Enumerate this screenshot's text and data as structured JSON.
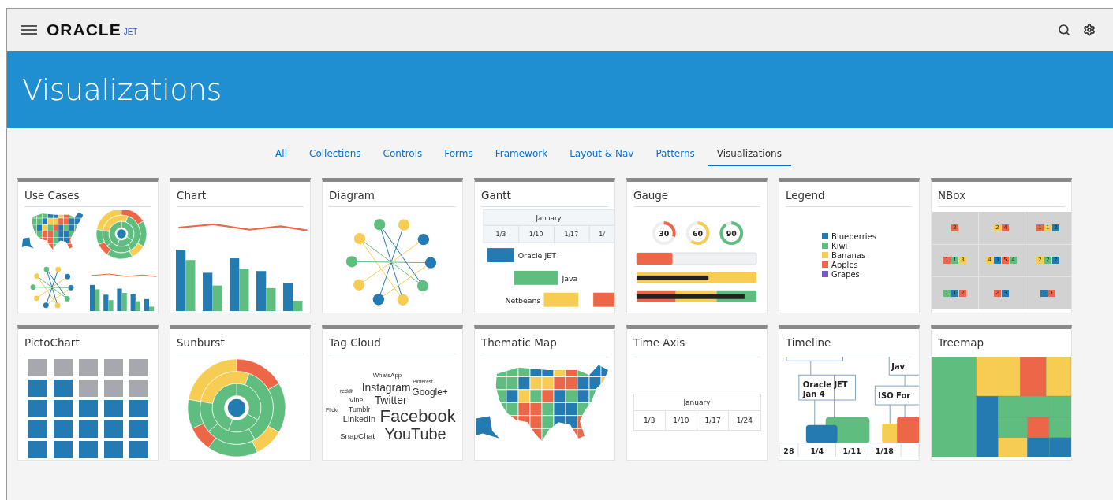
{
  "header": {
    "logo": "ORACLE",
    "product": "JET"
  },
  "banner": {
    "title": "Visualizations"
  },
  "tabs": [
    {
      "label": "All",
      "selected": false
    },
    {
      "label": "Collections",
      "selected": false
    },
    {
      "label": "Controls",
      "selected": false
    },
    {
      "label": "Forms",
      "selected": false
    },
    {
      "label": "Framework",
      "selected": false
    },
    {
      "label": "Layout & Nav",
      "selected": false
    },
    {
      "label": "Patterns",
      "selected": false
    },
    {
      "label": "Visualizations",
      "selected": true
    }
  ],
  "cards": [
    {
      "title": "Use Cases",
      "kind": "usecases"
    },
    {
      "title": "Chart",
      "kind": "chart"
    },
    {
      "title": "Diagram",
      "kind": "diagram"
    },
    {
      "title": "Gantt",
      "kind": "gantt",
      "month": "January",
      "dates": [
        "1/3",
        "1/10",
        "1/17",
        "1/"
      ],
      "tasks": [
        {
          "label": "Oracle JET",
          "color": "#237bb1"
        },
        {
          "label": "Java",
          "color": "#5fbe7f"
        },
        {
          "label": "Netbeans",
          "color": "#f6cd52"
        }
      ]
    },
    {
      "title": "Gauge",
      "kind": "gauge",
      "rings": [
        {
          "reading": "30",
          "level": 0.3,
          "color": "#ed6647"
        },
        {
          "reading": "60",
          "level": 0.6,
          "color": "#f6cd52"
        },
        {
          "reading": "90",
          "level": 0.9,
          "color": "#5fbe7f"
        }
      ],
      "bars": [
        {
          "kind": "plain",
          "level": 0.3
        },
        {
          "kind": "marker",
          "level": 0.6
        },
        {
          "kind": "ranged",
          "level": 0.9
        }
      ]
    },
    {
      "title": "Legend",
      "kind": "legend",
      "items": [
        {
          "label": "Blueberries",
          "color": "#237bb1"
        },
        {
          "label": "Kiwi",
          "color": "#5fbe7f"
        },
        {
          "label": "Bananas",
          "color": "#f6cd52"
        },
        {
          "label": "Apples",
          "color": "#ed6647"
        },
        {
          "label": "Grapes",
          "color": "#7e57c2"
        }
      ]
    },
    {
      "title": "NBox",
      "kind": "nbox",
      "cells": [
        [
          {
            "label": "2",
            "color": "#ed6647"
          }
        ],
        [
          {
            "label": "2",
            "color": "#f6cd52"
          },
          {
            "label": "4",
            "color": "#ed6647"
          }
        ],
        [
          {
            "label": "1",
            "color": "#ed6647"
          },
          {
            "label": "1",
            "color": "#f6cd52"
          },
          {
            "label": "2",
            "color": "#237bb1"
          }
        ],
        [
          {
            "label": "1",
            "color": "#ed6647"
          },
          {
            "label": "1",
            "color": "#5fbe7f"
          },
          {
            "label": "3",
            "color": "#f6cd52"
          }
        ],
        [
          {
            "label": "4",
            "color": "#f6cd52"
          },
          {
            "label": "3",
            "color": "#237bb1"
          },
          {
            "label": "5",
            "color": "#ed6647"
          },
          {
            "label": "4",
            "color": "#5fbe7f"
          }
        ],
        [
          {
            "label": "2",
            "color": "#f6cd52"
          },
          {
            "label": "2",
            "color": "#5fbe7f"
          },
          {
            "label": "2",
            "color": "#237bb1"
          }
        ],
        [
          {
            "label": "1",
            "color": "#5fbe7f"
          },
          {
            "label": "1",
            "color": "#237bb1"
          },
          {
            "label": "2",
            "color": "#ed6647"
          }
        ],
        [
          {
            "label": "2",
            "color": "#ed6647"
          },
          {
            "label": "3",
            "color": "#237bb1"
          }
        ],
        [
          {
            "label": "1",
            "color": "#237bb1"
          },
          {
            "label": "1",
            "color": "#ed6647"
          }
        ]
      ]
    },
    {
      "title": "PictoChart",
      "kind": "picto"
    },
    {
      "title": "Sunburst",
      "kind": "sunburst"
    },
    {
      "title": "Tag Cloud",
      "kind": "tagcloud",
      "words": [
        "WhatsApp",
        "Pinterest",
        "reddit",
        "Instagram",
        "Google+",
        "Vine",
        "Twitter",
        "Flickr",
        "Tumblr",
        "LinkedIn",
        "Facebook",
        "SnapChat",
        "YouTube"
      ]
    },
    {
      "title": "Thematic Map",
      "kind": "map"
    },
    {
      "title": "Time Axis",
      "kind": "timeaxis",
      "month": "January",
      "dates": [
        "1/3",
        "1/10",
        "1/17",
        "1/24"
      ]
    },
    {
      "title": "Timeline",
      "kind": "timeline",
      "events": [
        {
          "title": "Jav"
        },
        {
          "title": "Oracle JET",
          "date": "Jan 4"
        },
        {
          "title": "ISO For"
        }
      ],
      "axis": [
        "28",
        "1/4",
        "1/11",
        "1/18"
      ]
    },
    {
      "title": "Treemap",
      "kind": "treemap"
    }
  ]
}
